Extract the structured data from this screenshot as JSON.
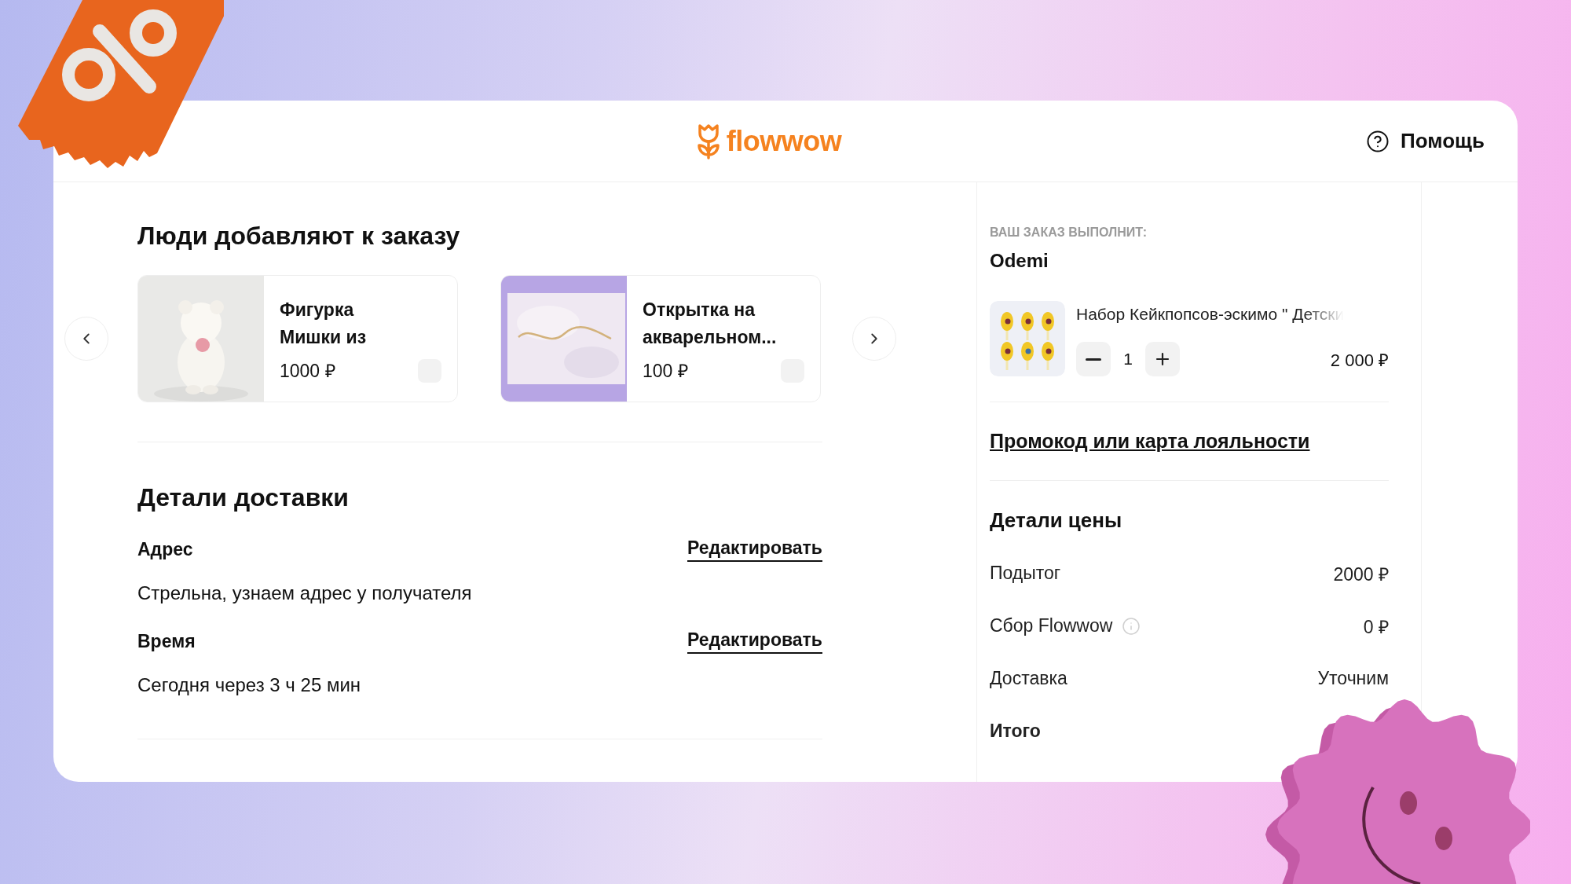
{
  "header": {
    "logo": "flowwow",
    "help": "Помощь"
  },
  "upsell": {
    "title": "Люди добавляют к заказу",
    "products": [
      {
        "name": "Фигурка Мишки из",
        "price": "1000 ₽",
        "kind": "figurine"
      },
      {
        "name": "Открытка на акварельном...",
        "price": "100 ₽",
        "kind": "postcard"
      }
    ]
  },
  "delivery": {
    "title": "Детали доставки",
    "fields": [
      {
        "label": "Адрес",
        "value": "Стрельна, узнаем адрес у получателя",
        "action": "Редактировать"
      },
      {
        "label": "Время",
        "value": "Сегодня через 3 ч 25 мин",
        "action": "Редактировать"
      }
    ]
  },
  "order": {
    "caption": "ВАШ ЗАКАЗ ВЫПОЛНИТ:",
    "seller": "Odemi",
    "items": [
      {
        "name": "Набор Кейкпопсов-эскимо \" Детски",
        "quantity": "1",
        "price": "2 000 ₽"
      }
    ],
    "promo_link": "Промокод или карта лояльности",
    "price_title": "Детали цены",
    "price_rows": [
      {
        "kind": "line",
        "label": "Подытог",
        "value": "2000 ₽",
        "info": false
      },
      {
        "kind": "line",
        "label": "Сбор Flowwow",
        "value": "0 ₽",
        "info": true
      },
      {
        "kind": "line",
        "label": "Доставка",
        "value": "Уточним",
        "info": false
      },
      {
        "kind": "total",
        "label": "Итого",
        "info": false
      }
    ]
  }
}
